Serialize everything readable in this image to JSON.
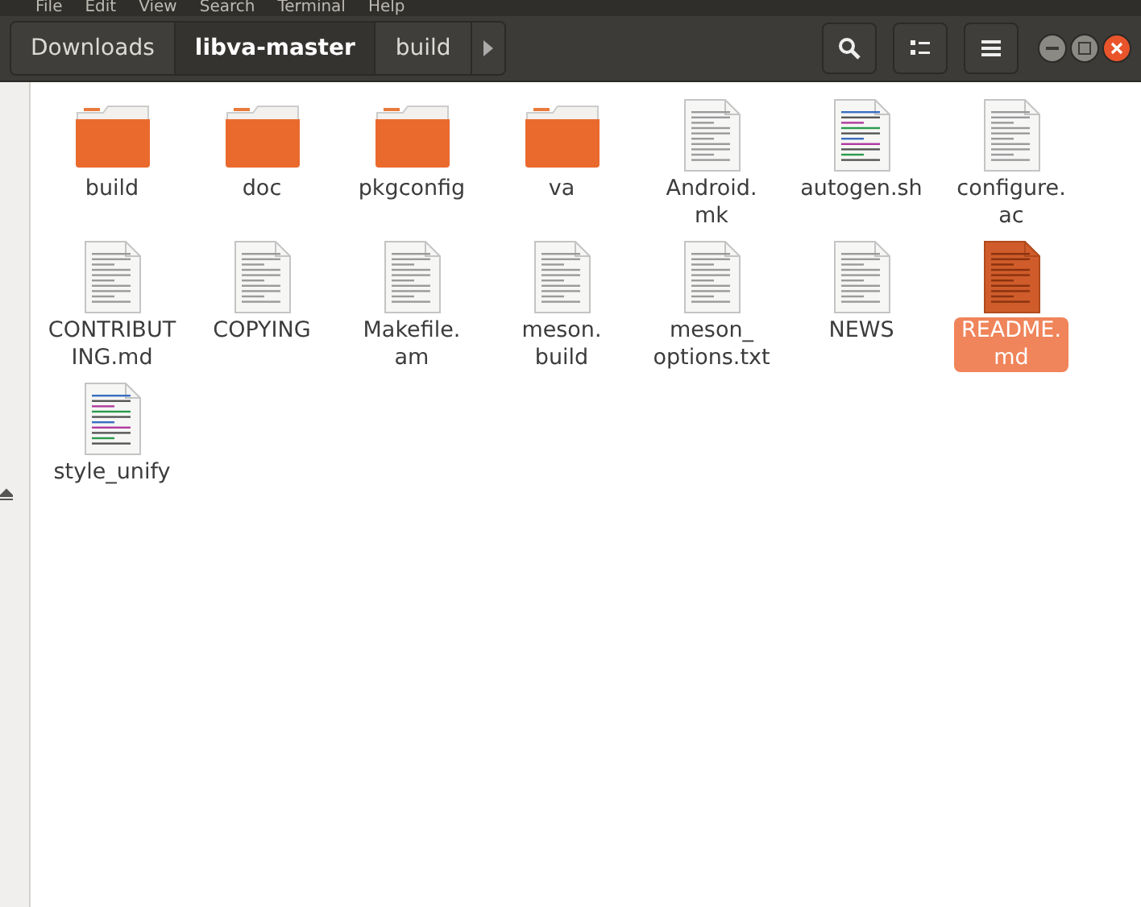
{
  "menu_bar": [
    "File",
    "Edit",
    "View",
    "Search",
    "Terminal",
    "Help"
  ],
  "path_bar": [
    {
      "label": "Downloads",
      "selected": false
    },
    {
      "label": "libva-master",
      "selected": true
    },
    {
      "label": "build",
      "selected": false
    }
  ],
  "files": [
    {
      "name": "build",
      "kind": "folder",
      "selected": false
    },
    {
      "name": "doc",
      "kind": "folder",
      "selected": false
    },
    {
      "name": "pkgconfig",
      "kind": "folder",
      "selected": false
    },
    {
      "name": "va",
      "kind": "folder",
      "selected": false
    },
    {
      "name": "Android.\nmk",
      "kind": "text",
      "selected": false
    },
    {
      "name": "autogen.sh",
      "kind": "script",
      "selected": false
    },
    {
      "name": "configure.\nac",
      "kind": "text",
      "selected": false
    },
    {
      "name": "CONTRIBUT\nING.md",
      "kind": "text",
      "selected": false
    },
    {
      "name": "COPYING",
      "kind": "text",
      "selected": false
    },
    {
      "name": "Makefile.\nam",
      "kind": "text",
      "selected": false
    },
    {
      "name": "meson.\nbuild",
      "kind": "text",
      "selected": false
    },
    {
      "name": "meson_\noptions.txt",
      "kind": "text",
      "selected": false
    },
    {
      "name": "NEWS",
      "kind": "text",
      "selected": false
    },
    {
      "name": "README.\nmd",
      "kind": "text",
      "selected": true
    },
    {
      "name": "style_unify",
      "kind": "script",
      "selected": false
    }
  ]
}
